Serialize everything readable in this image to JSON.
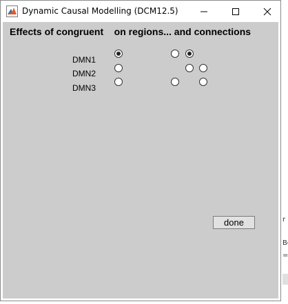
{
  "window": {
    "title": "Dynamic Causal Modelling (DCM12.5)"
  },
  "heading": {
    "text": "Effects of congruent    on regions... and connections"
  },
  "regions": [
    {
      "label": "DMN1"
    },
    {
      "label": "DMN2"
    },
    {
      "label": "DMN3"
    }
  ],
  "region_inputs": [
    true,
    false,
    false
  ],
  "connections": {
    "row1": [
      false,
      true
    ],
    "row2": [
      false,
      false
    ],
    "row3": [
      false,
      false
    ]
  },
  "done_button": {
    "label": "done"
  },
  "background_fragments": {
    "a": "r",
    "b": "Bo",
    "c": "="
  },
  "colors": {
    "panel_bg": "#cccccc",
    "titlebar_bg": "#ffffff"
  }
}
